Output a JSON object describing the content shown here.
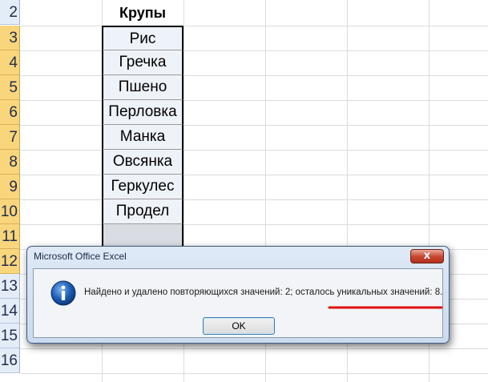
{
  "sheet": {
    "row_numbers": [
      "2",
      "3",
      "4",
      "5",
      "6",
      "7",
      "8",
      "9",
      "10",
      "11",
      "12",
      "13",
      "14",
      "15",
      "16"
    ],
    "column_header": "Крупы",
    "items": [
      "Рис",
      "Гречка",
      "Пшено",
      "Перловка",
      "Манка",
      "Овсянка",
      "Геркулес",
      "Продел"
    ]
  },
  "dialog": {
    "title": "Microsoft Office Excel",
    "close_glyph": "x",
    "message": "Найдено и удалено повторяющихся значений: 2; осталось уникальных значений: 8.",
    "ok_label": "OK"
  },
  "colors": {
    "row_header_selected": "#f9d57c",
    "row_header_plain": "#e4ecf7",
    "underline_annotation": "#e01010",
    "info_icon": "#1d5fb8"
  },
  "icons": {
    "info": "information-icon",
    "close": "close-icon"
  }
}
